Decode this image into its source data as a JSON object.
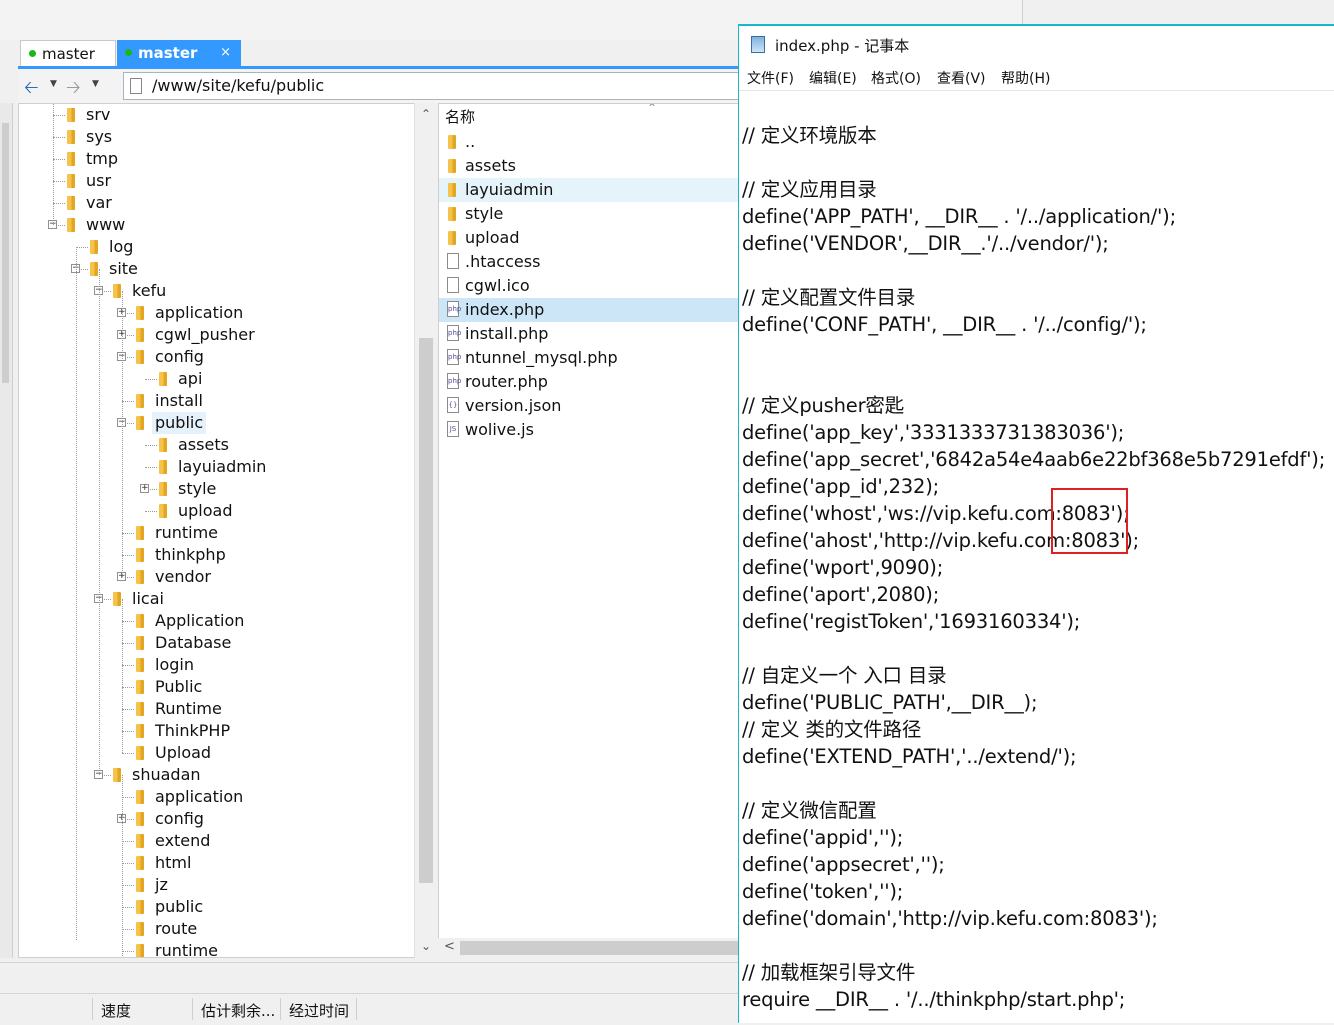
{
  "tabs": [
    {
      "label": "master",
      "active": false
    },
    {
      "label": "master",
      "active": true,
      "close": "×"
    }
  ],
  "navbar": {
    "back_icon": "back-arrow-icon",
    "forward_icon": "forward-arrow-icon",
    "path": "/www/site/kefu/public"
  },
  "tree": [
    {
      "label": "srv",
      "depth": 1,
      "exp": ""
    },
    {
      "label": "sys",
      "depth": 1,
      "exp": ""
    },
    {
      "label": "tmp",
      "depth": 1,
      "exp": ""
    },
    {
      "label": "usr",
      "depth": 1,
      "exp": ""
    },
    {
      "label": "var",
      "depth": 1,
      "exp": ""
    },
    {
      "label": "www",
      "depth": 1,
      "exp": "−"
    },
    {
      "label": "log",
      "depth": 2,
      "exp": ""
    },
    {
      "label": "site",
      "depth": 2,
      "exp": "−"
    },
    {
      "label": "kefu",
      "depth": 3,
      "exp": "−"
    },
    {
      "label": "application",
      "depth": 4,
      "exp": "+"
    },
    {
      "label": "cgwl_pusher",
      "depth": 4,
      "exp": "+"
    },
    {
      "label": "config",
      "depth": 4,
      "exp": "−"
    },
    {
      "label": "api",
      "depth": 5,
      "exp": ""
    },
    {
      "label": "install",
      "depth": 4,
      "exp": ""
    },
    {
      "label": "public",
      "depth": 4,
      "exp": "−",
      "selected": true
    },
    {
      "label": "assets",
      "depth": 5,
      "exp": ""
    },
    {
      "label": "layuiadmin",
      "depth": 5,
      "exp": ""
    },
    {
      "label": "style",
      "depth": 5,
      "exp": "+"
    },
    {
      "label": "upload",
      "depth": 5,
      "exp": ""
    },
    {
      "label": "runtime",
      "depth": 4,
      "exp": ""
    },
    {
      "label": "thinkphp",
      "depth": 4,
      "exp": ""
    },
    {
      "label": "vendor",
      "depth": 4,
      "exp": "+"
    },
    {
      "label": "licai",
      "depth": 3,
      "exp": "−"
    },
    {
      "label": "Application",
      "depth": 4,
      "exp": ""
    },
    {
      "label": "Database",
      "depth": 4,
      "exp": ""
    },
    {
      "label": "login",
      "depth": 4,
      "exp": ""
    },
    {
      "label": "Public",
      "depth": 4,
      "exp": ""
    },
    {
      "label": "Runtime",
      "depth": 4,
      "exp": ""
    },
    {
      "label": "ThinkPHP",
      "depth": 4,
      "exp": ""
    },
    {
      "label": "Upload",
      "depth": 4,
      "exp": ""
    },
    {
      "label": "shuadan",
      "depth": 3,
      "exp": "−"
    },
    {
      "label": "application",
      "depth": 4,
      "exp": ""
    },
    {
      "label": "config",
      "depth": 4,
      "exp": "+"
    },
    {
      "label": "extend",
      "depth": 4,
      "exp": ""
    },
    {
      "label": "html",
      "depth": 4,
      "exp": ""
    },
    {
      "label": "jz",
      "depth": 4,
      "exp": ""
    },
    {
      "label": "public",
      "depth": 4,
      "exp": ""
    },
    {
      "label": "route",
      "depth": 4,
      "exp": ""
    },
    {
      "label": "runtime",
      "depth": 4,
      "exp": ""
    }
  ],
  "files": {
    "column_header": "名称",
    "items": [
      {
        "name": "..",
        "type": "folder"
      },
      {
        "name": "assets",
        "type": "folder"
      },
      {
        "name": "layuiadmin",
        "type": "folder",
        "state": "hover"
      },
      {
        "name": "style",
        "type": "folder"
      },
      {
        "name": "upload",
        "type": "folder"
      },
      {
        "name": ".htaccess",
        "type": "file"
      },
      {
        "name": "cgwl.ico",
        "type": "file"
      },
      {
        "name": "index.php",
        "type": "php",
        "state": "selected"
      },
      {
        "name": "install.php",
        "type": "php"
      },
      {
        "name": "ntunnel_mysql.php",
        "type": "php"
      },
      {
        "name": "router.php",
        "type": "php"
      },
      {
        "name": "version.json",
        "type": "json"
      },
      {
        "name": "wolive.js",
        "type": "js"
      }
    ]
  },
  "status": {
    "speed": "速度",
    "remaining": "估计剩余...",
    "elapsed": "经过时间"
  },
  "notepad": {
    "title": "index.php - 记事本",
    "menu": [
      "文件(F)",
      "编辑(E)",
      "格式(O)",
      "查看(V)",
      "帮助(H)"
    ],
    "lines": [
      "// 定义环境版本",
      "",
      "// 定义应用目录",
      "define('APP_PATH', __DIR__ . '/../application/');",
      "define('VENDOR',__DIR__.'/../vendor/');",
      "",
      "// 定义配置文件目录",
      "define('CONF_PATH', __DIR__ . '/../config/');",
      "",
      "",
      "// 定义pusher密匙",
      "define('app_key','3331333731383036');",
      "define('app_secret','6842a54e4aab6e22bf368e5b7291efdf');",
      "define('app_id',232);",
      "define('whost','ws://vip.kefu.com:8083');",
      "define('ahost','http://vip.kefu.com:8083');",
      "define('wport',9090);",
      "define('aport',2080);",
      "define('registToken','1693160334');",
      "",
      "// 自定义一个 入口 目录",
      "define('PUBLIC_PATH',__DIR__);",
      "// 定义 类的文件路径",
      "define('EXTEND_PATH','../extend/');",
      "",
      "// 定义微信配置",
      "define('appid','');",
      "define('appsecret','');",
      "define('token','');",
      "define('domain','http://vip.kefu.com:8083');",
      "",
      "// 加载框架引导文件",
      "require __DIR__ . '/../thinkphp/start.php';"
    ]
  },
  "colors": {
    "accent": "#3399ff",
    "highlight_box": "#e02020",
    "folder": "#f6c34a"
  }
}
